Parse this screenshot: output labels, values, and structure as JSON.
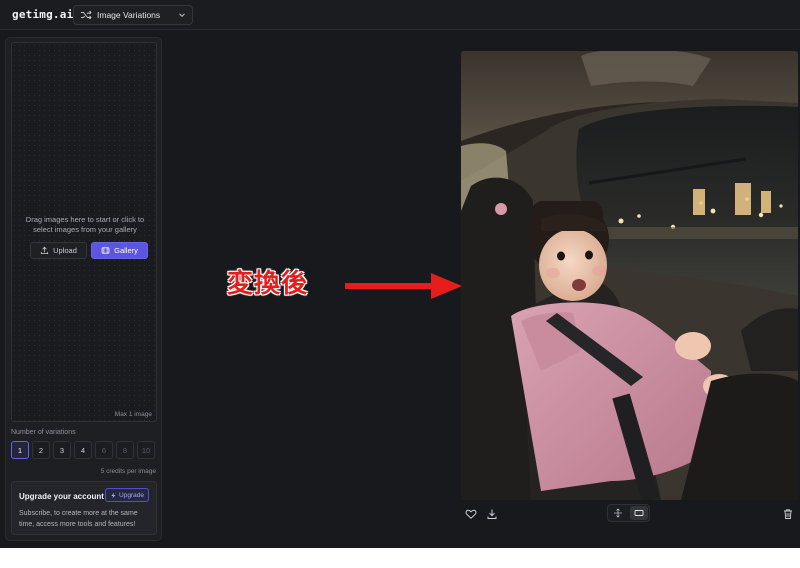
{
  "app": {
    "logo": "getimg.ai",
    "tool_selector": {
      "label": "Image Variations",
      "icon": "shuffle-icon"
    }
  },
  "sidebar": {
    "dropzone": {
      "instruction": "Drag images here to start or click to select images from your gallery",
      "upload_label": "Upload",
      "gallery_label": "Gallery",
      "max_note": "Max 1 image"
    },
    "variations": {
      "label": "Number of variations",
      "options": [
        "1",
        "2",
        "3",
        "4",
        "6",
        "8",
        "10"
      ],
      "selected": "1",
      "disabled": [
        "6",
        "8",
        "10"
      ],
      "credits_note": "5 credits per image"
    },
    "upgrade": {
      "title": "Upgrade your account",
      "button_label": "Upgrade",
      "text": "Subscribe, to create more at the same time, access more tools and features!"
    }
  },
  "annotation": {
    "text": "変換後",
    "color": "#e51d1d"
  },
  "colors": {
    "accent": "#5b55e0",
    "background": "#18191d",
    "panel": "#1e1f23"
  },
  "result_actions": {
    "left": [
      "heart-icon",
      "download-icon"
    ],
    "center": [
      "fit-icon",
      "aspect-ratio-icon"
    ],
    "right": [
      "trash-icon"
    ]
  }
}
